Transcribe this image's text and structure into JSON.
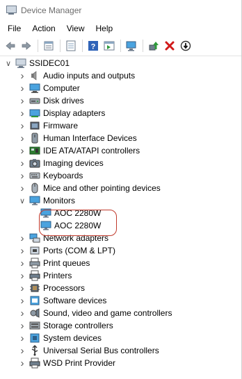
{
  "window": {
    "title": "Device Manager"
  },
  "menu": [
    "File",
    "Action",
    "View",
    "Help"
  ],
  "toolbar": {
    "buttons": [
      {
        "name": "back-arrow-icon"
      },
      {
        "name": "forward-arrow-icon"
      },
      {
        "name": "properties-icon"
      },
      {
        "name": "console-tree-icon"
      },
      {
        "name": "help-icon"
      },
      {
        "name": "action-pane-icon"
      },
      {
        "name": "scan-hardware-icon"
      },
      {
        "name": "update-driver-icon"
      },
      {
        "name": "uninstall-icon"
      },
      {
        "name": "disable-device-icon"
      }
    ]
  },
  "tree": {
    "root": "SSIDEC01",
    "categories": [
      {
        "label": "Audio inputs and outputs",
        "icon": "speaker-icon",
        "expanded": false
      },
      {
        "label": "Computer",
        "icon": "computer-icon",
        "expanded": false
      },
      {
        "label": "Disk drives",
        "icon": "disk-drive-icon",
        "expanded": false
      },
      {
        "label": "Display adapters",
        "icon": "display-adapter-icon",
        "expanded": false
      },
      {
        "label": "Firmware",
        "icon": "firmware-icon",
        "expanded": false
      },
      {
        "label": "Human Interface Devices",
        "icon": "hid-icon",
        "expanded": false
      },
      {
        "label": "IDE ATA/ATAPI controllers",
        "icon": "ide-controller-icon",
        "expanded": false
      },
      {
        "label": "Imaging devices",
        "icon": "camera-icon",
        "expanded": false
      },
      {
        "label": "Keyboards",
        "icon": "keyboard-icon",
        "expanded": false
      },
      {
        "label": "Mice and other pointing devices",
        "icon": "mouse-icon",
        "expanded": false
      },
      {
        "label": "Monitors",
        "icon": "monitor-icon",
        "expanded": true,
        "children": [
          "AOC 2280W",
          "AOC 2280W"
        ]
      },
      {
        "label": "Network adapters",
        "icon": "network-adapter-icon",
        "expanded": false
      },
      {
        "label": "Ports (COM & LPT)",
        "icon": "port-icon",
        "expanded": false
      },
      {
        "label": "Print queues",
        "icon": "print-queue-icon",
        "expanded": false
      },
      {
        "label": "Printers",
        "icon": "printer-icon",
        "expanded": false
      },
      {
        "label": "Processors",
        "icon": "processor-icon",
        "expanded": false
      },
      {
        "label": "Software devices",
        "icon": "software-device-icon",
        "expanded": false
      },
      {
        "label": "Sound, video and game controllers",
        "icon": "sound-controller-icon",
        "expanded": false
      },
      {
        "label": "Storage controllers",
        "icon": "storage-controller-icon",
        "expanded": false
      },
      {
        "label": "System devices",
        "icon": "system-device-icon",
        "expanded": false
      },
      {
        "label": "Universal Serial Bus controllers",
        "icon": "usb-icon",
        "expanded": false
      },
      {
        "label": "WSD Print Provider",
        "icon": "wsd-printer-icon",
        "expanded": false
      }
    ]
  },
  "colors": {
    "accent": "#1e73be",
    "highlight_ring": "#c0392b",
    "uninstall_red": "#d11a1a",
    "update_green": "#2e9a3a"
  }
}
